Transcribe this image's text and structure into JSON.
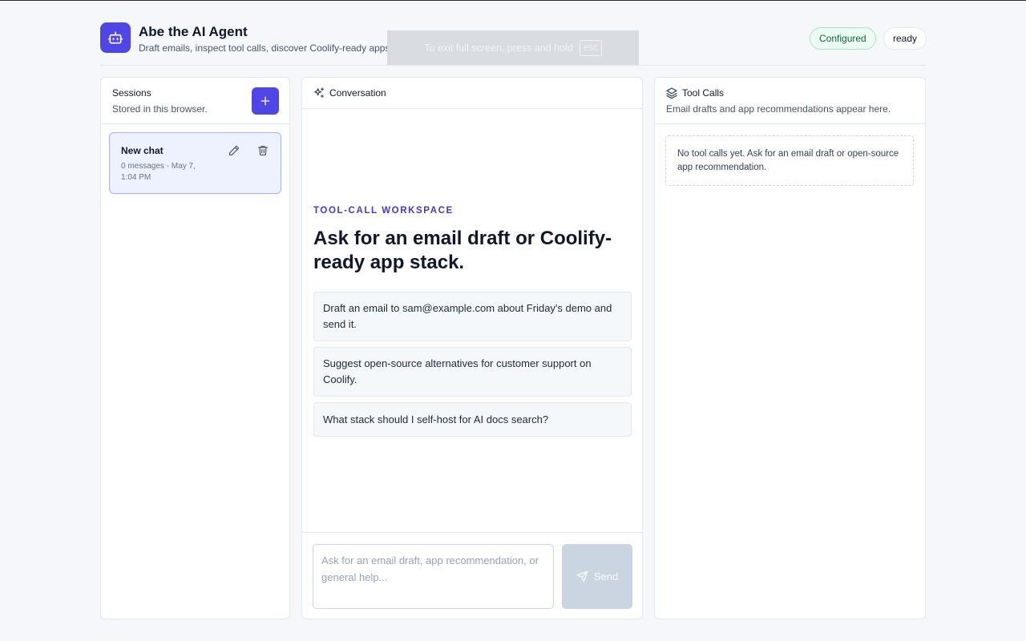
{
  "header": {
    "title": "Abe the AI Agent",
    "subtitle": "Draft emails, inspect tool calls, discover Coolify-ready apps.",
    "badges": {
      "configured": "Configured",
      "status": "ready"
    },
    "logo_icon": "robot-icon"
  },
  "fullscreen_notice": {
    "text": "To exit full screen, press and hold",
    "key": "esc"
  },
  "sessions": {
    "title": "Sessions",
    "description": "Stored in this browser.",
    "new_button_icon": "plus-icon",
    "items": [
      {
        "title": "New chat",
        "meta": "0 messages - May 7, 1:04 PM"
      }
    ]
  },
  "conversation": {
    "title": "Conversation",
    "eyebrow": "TOOL-CALL WORKSPACE",
    "heading": "Ask for an email draft or Coolify-ready app stack.",
    "prompts": [
      "Draft an email to sam@example.com about Friday's demo and send it.",
      "Suggest open-source alternatives for customer support on Coolify.",
      "What stack should I self-host for AI docs search?"
    ],
    "input_placeholder": "Ask for an email draft, app recommendation, or general help...",
    "send_label": "Send"
  },
  "tool_calls": {
    "title": "Tool Calls",
    "description": "Email drafts and app recommendations appear here.",
    "empty": "No tool calls yet. Ask for an email draft or open-source app recommendation."
  },
  "colors": {
    "accent": "#4f46e5",
    "background": "#f5f7fb",
    "configured_bg": "#ecfdf3",
    "configured_text": "#166534"
  }
}
